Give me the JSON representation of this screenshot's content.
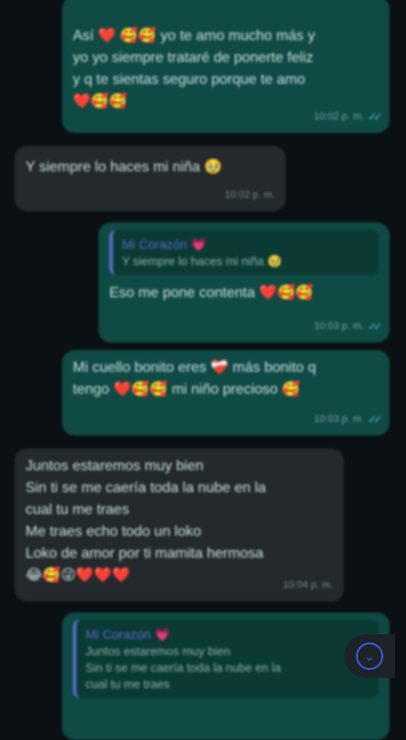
{
  "messages": [
    {
      "id": "m0",
      "direction": "out",
      "lines": [
        "Así ❤️ 🥰🥰 yo te amo mucho más y",
        "yo yo siempre trataré de ponerte feliz",
        "y q te sientas seguro porque te amo",
        "❤️🥰🥰"
      ],
      "time": "10:02 p. m.",
      "status": "read"
    },
    {
      "id": "m1",
      "direction": "in",
      "lines": [
        "Y siempre lo haces mi niña 🥹"
      ],
      "time": "10:02 p. m."
    },
    {
      "id": "m2",
      "direction": "out",
      "quote": {
        "author": "Mi Corazón 💗",
        "text": "Y siempre lo haces mi niña 🥹"
      },
      "lines": [
        "Eso me pone contenta ❤️🥰🥰"
      ],
      "time": "10:03 p. m.",
      "status": "read"
    },
    {
      "id": "m3",
      "direction": "out",
      "lines": [
        "Mi cuello bonito eres ❤️‍🩹 más bonito q",
        "tengo ❤️🥰🥰 mi niño precioso 🥰"
      ],
      "time": "10:03 p. m.",
      "status": "read"
    },
    {
      "id": "m4",
      "direction": "in",
      "lines": [
        "Juntos estaremos muy bien",
        "Sin ti se me caería toda la nube en la",
        "cual tu me traes",
        "Me traes echo todo un loko",
        "Loko de amor por ti mamita hermosa",
        "😂🥰😜❤️❤️❤️"
      ],
      "time": "10:04 p. m."
    },
    {
      "id": "m5",
      "direction": "out",
      "quote": {
        "author": "Mi Corazón 💗",
        "text": "Juntos estaremos muy bien\nSin ti se me caería toda la nube en la\ncual tu me traes"
      },
      "lines": [],
      "time": "",
      "status": ""
    }
  ],
  "icons": {
    "scroll_down": "chevron-down-circle-icon",
    "read_ticks": "double-check-icon"
  },
  "colors": {
    "outgoing": "#0f4a44",
    "incoming": "#23292d",
    "accent_quote": "#5b6ac9",
    "ticks": "#53bdeb"
  }
}
